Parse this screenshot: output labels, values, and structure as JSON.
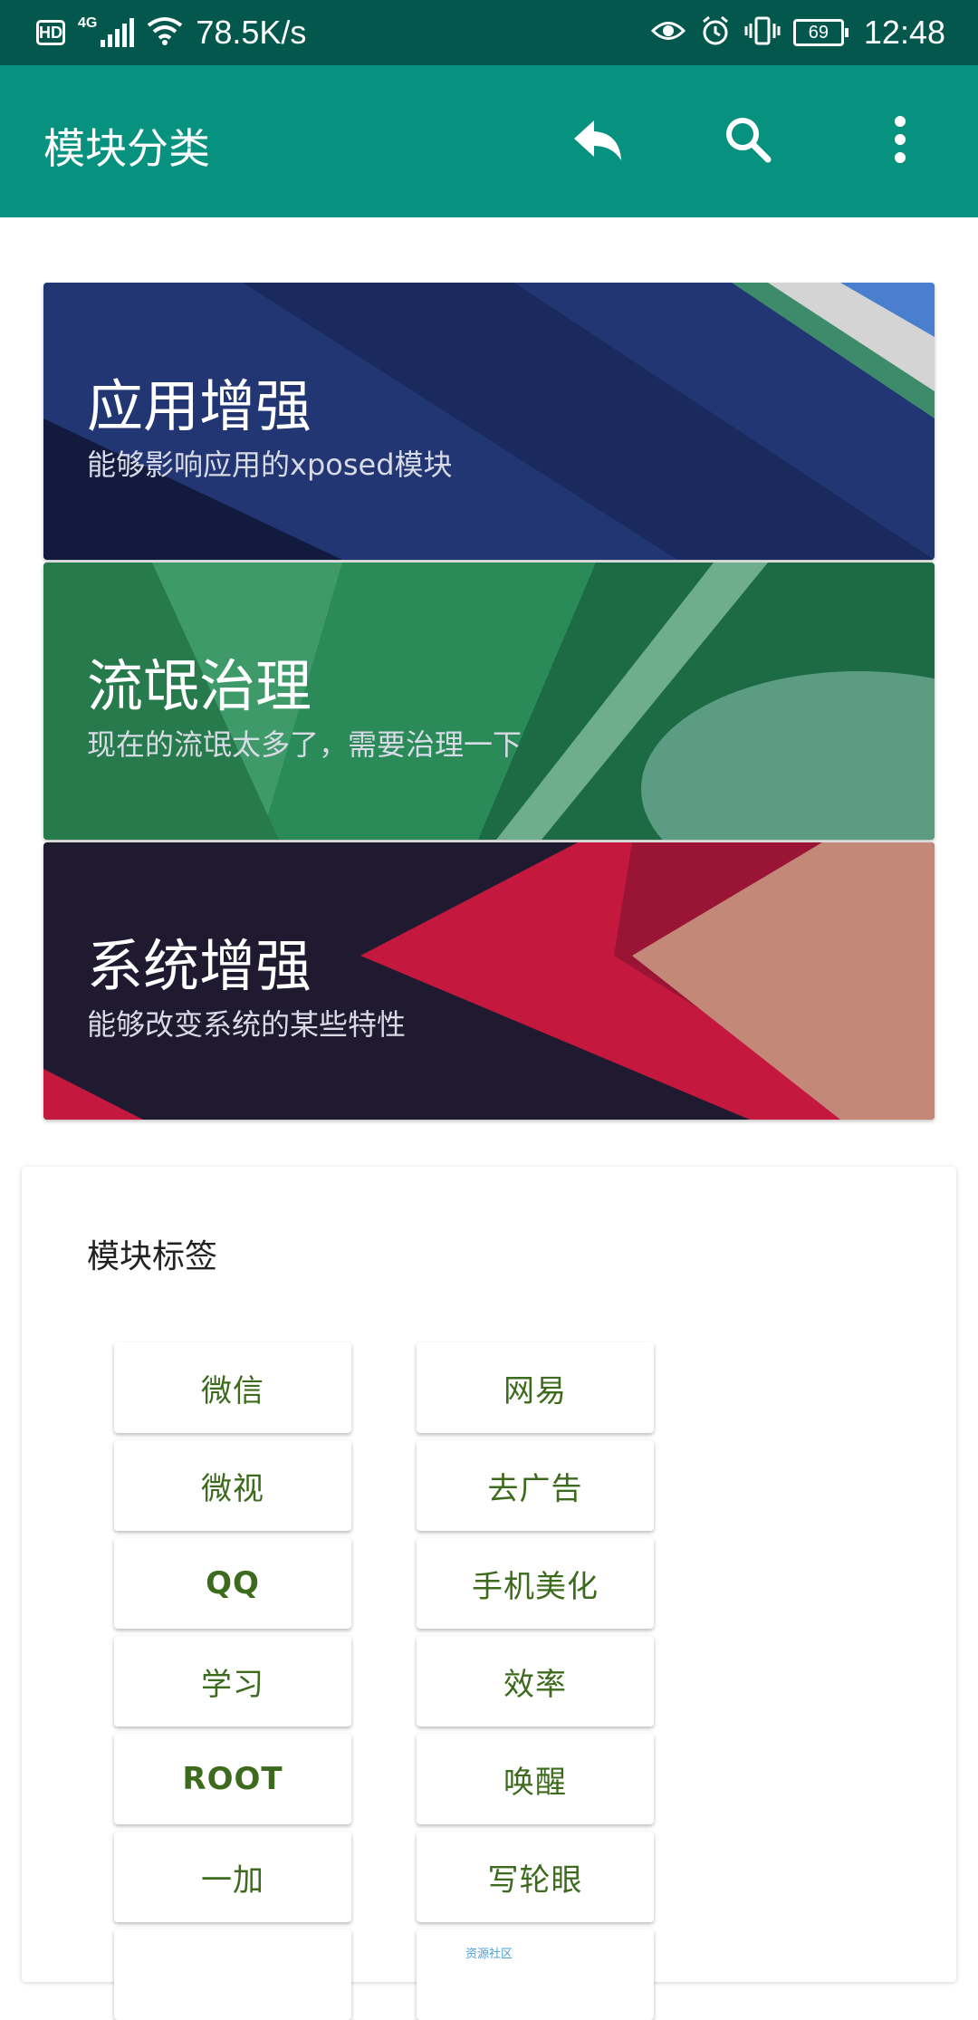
{
  "status_bar": {
    "hd": "HD",
    "network": "4G",
    "speed": "78.5K/s",
    "battery": "69",
    "time": "12:48"
  },
  "app_bar": {
    "title": "模块分类",
    "icons": [
      "reply-icon",
      "search-icon",
      "more-vert-icon"
    ],
    "color": "#079280"
  },
  "categories": [
    {
      "title": "应用增强",
      "subtitle": "能够影响应用的xposed模块"
    },
    {
      "title": "流氓治理",
      "subtitle": "现在的流氓太多了，需要治理一下"
    },
    {
      "title": "系统增强",
      "subtitle": "能够改变系统的某些特性"
    }
  ],
  "tags_panel": {
    "title": "模块标签",
    "tags": [
      "微信",
      "网易",
      "微视",
      "去广告",
      "QQ",
      "手机美化",
      "学习",
      "效率",
      "ROOT",
      "唤醒",
      "一加",
      "写轮眼"
    ],
    "footnote": "资源社区",
    "tag_text_color": "#3d6b1d"
  }
}
